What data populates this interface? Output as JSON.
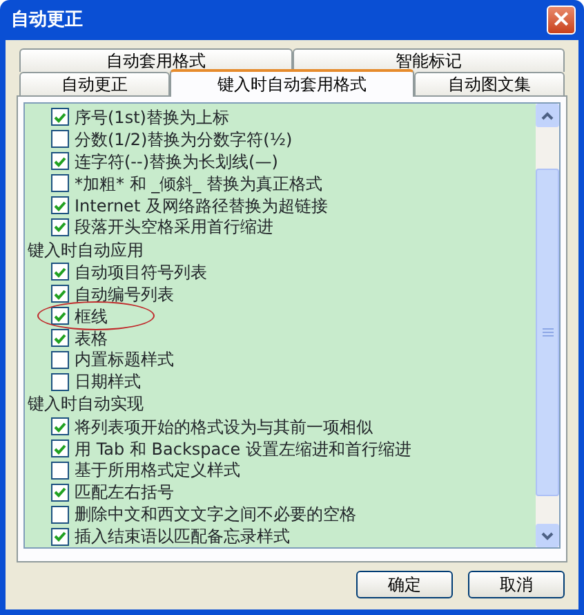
{
  "window": {
    "title": "自动更正",
    "close_label": "×"
  },
  "tab_rows": [
    [
      {
        "label": "自动套用格式",
        "selected": false
      },
      {
        "label": "智能标记",
        "selected": false
      }
    ],
    [
      {
        "label": "自动更正",
        "selected": false
      },
      {
        "label": "键入时自动套用格式",
        "selected": true
      },
      {
        "label": "自动图文集",
        "selected": false
      }
    ]
  ],
  "options": [
    {
      "kind": "check",
      "label": "序号(1st)替换为上标",
      "checked": true
    },
    {
      "kind": "check",
      "label": "分数(1/2)替换为分数字符(½)",
      "checked": false
    },
    {
      "kind": "check",
      "label": "连字符(--)替换为长划线(—)",
      "checked": true
    },
    {
      "kind": "check",
      "label": "*加粗* 和 _倾斜_ 替换为真正格式",
      "checked": false
    },
    {
      "kind": "check",
      "label": "Internet 及网络路径替换为超链接",
      "checked": true
    },
    {
      "kind": "check",
      "label": "段落开头空格采用首行缩进",
      "checked": true
    },
    {
      "kind": "heading",
      "label": "键入时自动应用"
    },
    {
      "kind": "check",
      "label": "自动项目符号列表",
      "checked": true
    },
    {
      "kind": "check",
      "label": "自动编号列表",
      "checked": true
    },
    {
      "kind": "check",
      "label": "框线",
      "checked": true,
      "circled": true
    },
    {
      "kind": "check",
      "label": "表格",
      "checked": true
    },
    {
      "kind": "check",
      "label": "内置标题样式",
      "checked": false
    },
    {
      "kind": "check",
      "label": "日期样式",
      "checked": false
    },
    {
      "kind": "heading",
      "label": "键入时自动实现"
    },
    {
      "kind": "check",
      "label": "将列表项开始的格式设为与其前一项相似",
      "checked": true
    },
    {
      "kind": "check",
      "label": "用 Tab 和 Backspace 设置左缩进和首行缩进",
      "checked": true
    },
    {
      "kind": "check",
      "label": "基于所用格式定义样式",
      "checked": false
    },
    {
      "kind": "check",
      "label": "匹配左右括号",
      "checked": true
    },
    {
      "kind": "check",
      "label": "删除中文和西文文字之间不必要的空格",
      "checked": false
    },
    {
      "kind": "check",
      "label": "插入结束语以匹配备忘录样式",
      "checked": true
    }
  ],
  "buttons": [
    "确定",
    "取消"
  ]
}
